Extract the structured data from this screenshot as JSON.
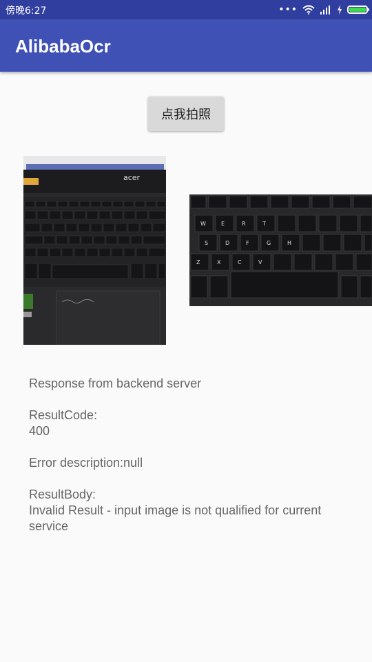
{
  "status_bar": {
    "time": "傍晚6:27",
    "icons": [
      "dots-icon",
      "wifi-icon",
      "signal-icon",
      "charging-icon",
      "battery-icon"
    ],
    "battery_color": "#3ddc4a"
  },
  "app_bar": {
    "title": "AlibabaOcr",
    "color": "#3f51b5"
  },
  "main": {
    "take_photo_label": "点我拍照",
    "photo_brand_text": "acer",
    "response": {
      "heading": "Response from backend server",
      "result_code_label": "ResultCode:",
      "result_code": "400",
      "error_description": "Error description:null",
      "result_body_label": "ResultBody:",
      "result_body": "Invalid Result - input image is not qualified for current service"
    }
  }
}
